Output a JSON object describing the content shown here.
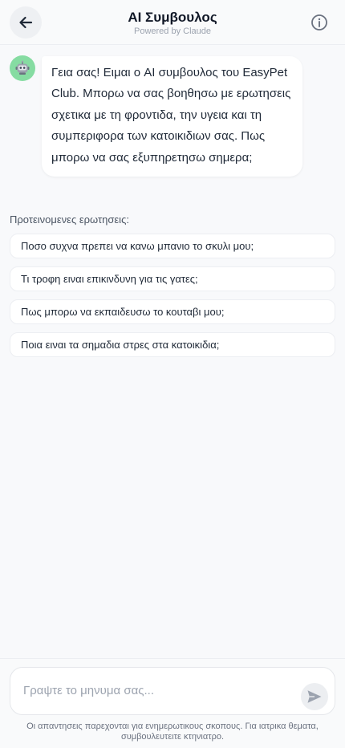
{
  "header": {
    "title": "AI Συμβουλος",
    "subtitle": "Powered by Claude",
    "back_icon": "arrow-left-icon",
    "info_icon": "info-circle-icon"
  },
  "chat": {
    "assistant_avatar_icon": "robot-icon",
    "messages": [
      {
        "role": "assistant",
        "text": "Γεια σας! Ειμαι ο AI συμβουλος του EasyPet Club. Μπορω να σας βοηθησω με ερωτησεις σχετικα με τη φροντιδα, την υγεια και τη συμπεριφορα των κατοικιδιων σας. Πως μπορω να σας εξυπηρετησω σημερα;"
      }
    ]
  },
  "suggestions": {
    "label": "Προτεινομενες ερωτησεις:",
    "items": [
      "Ποσο συχνα πρεπει να κανω μπανιο το σκυλι μου;",
      "Τι τροφη ειναι επικινδυνη για τις γατες;",
      "Πως μπορω να εκπαιδευσω το κουταβι μου;",
      "Ποια ειναι τα σημαδια στρες στα κατοικιδια;"
    ]
  },
  "composer": {
    "value": "",
    "placeholder": "Γραψτε το μηνυμα σας...",
    "send_icon": "send-icon"
  },
  "disclaimer": "Οι απαντησεις παρεχονται για ενημερωτικους σκοπους. Για ιατρικα θεματα, συμβουλευτειτε κτηνιατρο.",
  "colors": {
    "background": "#f8f9fb",
    "avatar_bg": "#86dca2",
    "text_primary": "#111827",
    "text_muted": "#9ca3af"
  }
}
